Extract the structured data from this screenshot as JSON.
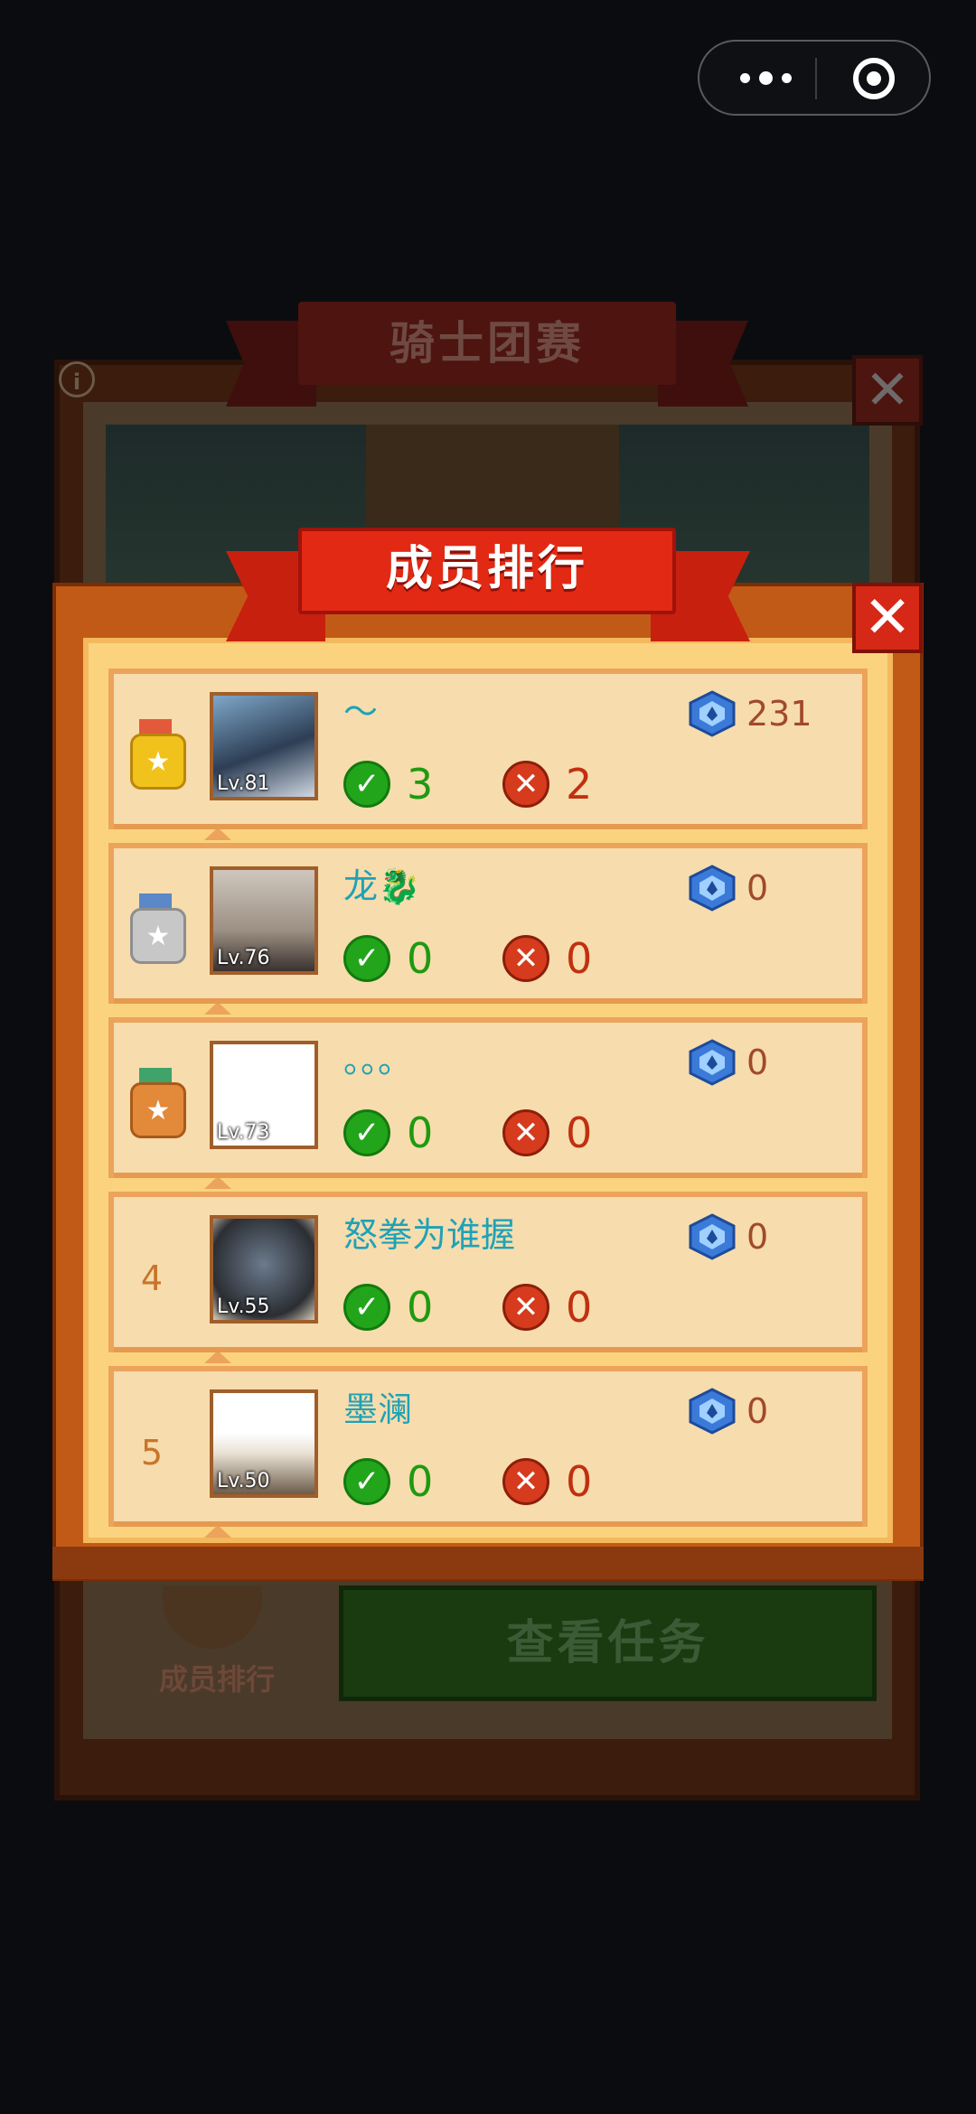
{
  "background_panel": {
    "title": "骑士团赛",
    "info_icon": "info-icon",
    "close_icon": "close-icon",
    "ranking_label": "成员排行",
    "task_button_label": "查看任务"
  },
  "modal": {
    "title": "成员排行",
    "close_icon": "close-icon"
  },
  "members": [
    {
      "rank": "1",
      "medal": "gold",
      "name": "～",
      "level": "Lv.81",
      "score": "231",
      "wins": "3",
      "losses": "2"
    },
    {
      "rank": "2",
      "medal": "silver",
      "name": "龙🐉",
      "level": "Lv.76",
      "score": "0",
      "wins": "0",
      "losses": "0"
    },
    {
      "rank": "3",
      "medal": "bronze",
      "name": "。。。",
      "level": "Lv.73",
      "score": "0",
      "wins": "0",
      "losses": "0"
    },
    {
      "rank": "4",
      "medal": "",
      "name": "怒拳为谁握",
      "level": "Lv.55",
      "score": "0",
      "wins": "0",
      "losses": "0"
    },
    {
      "rank": "5",
      "medal": "",
      "name": "墨澜",
      "level": "Lv.50",
      "score": "0",
      "wins": "0",
      "losses": "0"
    }
  ],
  "colors": {
    "accent_name": "#1fa2b6",
    "win": "#22a51a",
    "loss": "#d63b1d",
    "gold": "#f1c21b",
    "silver": "#c7c7c7",
    "bronze": "#e3893a"
  }
}
